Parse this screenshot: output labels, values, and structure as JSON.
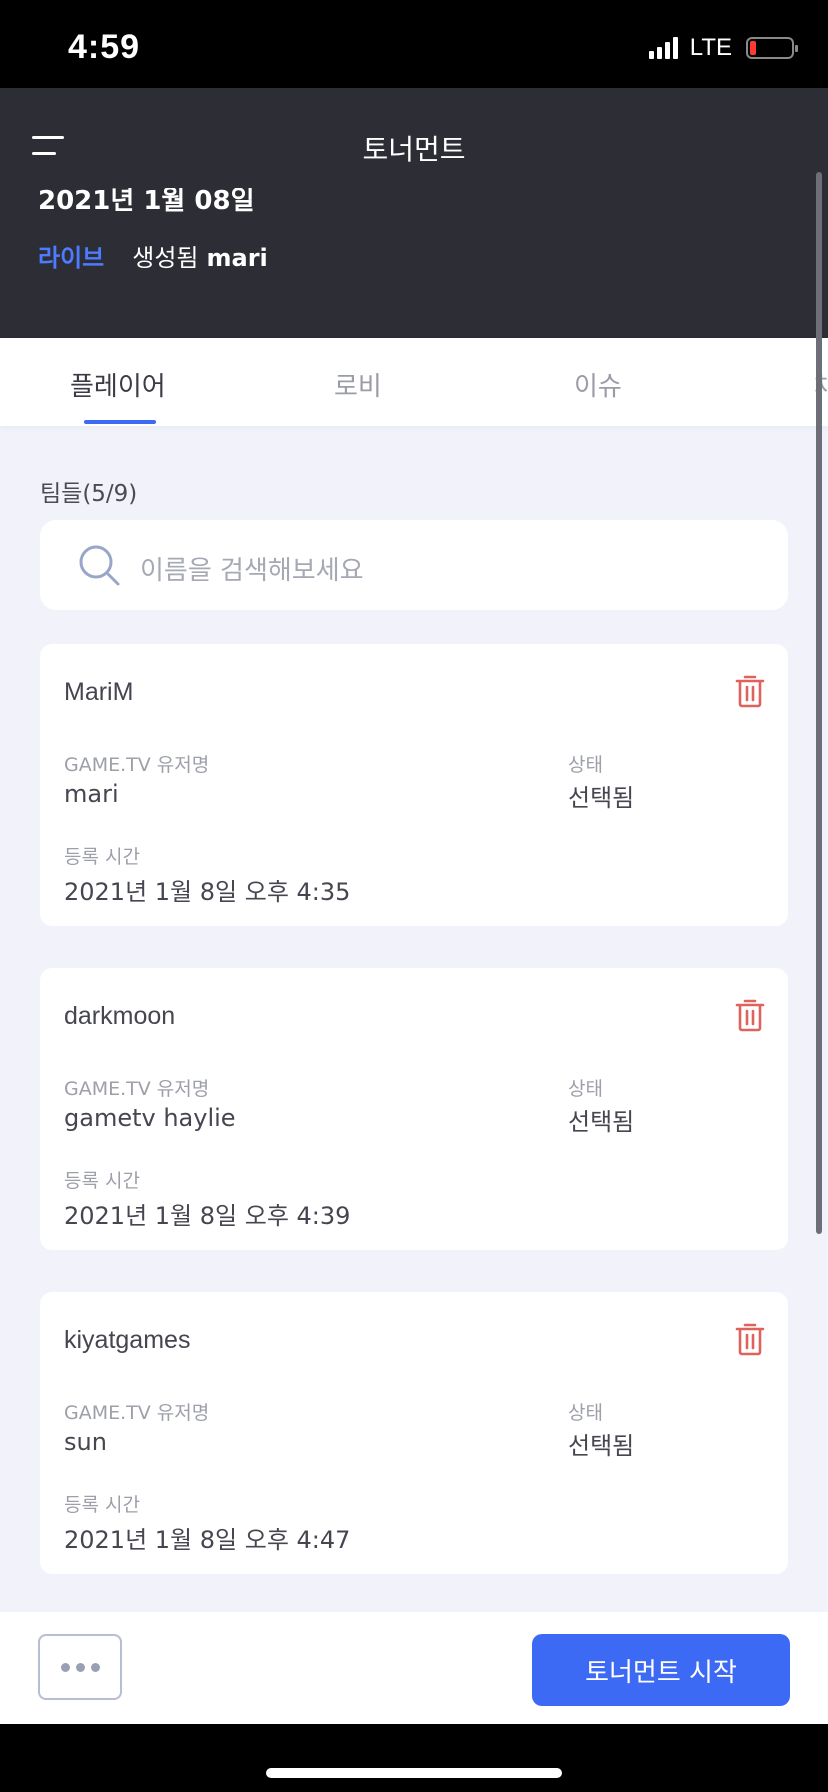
{
  "status_bar": {
    "time": "4:59",
    "network": "LTE"
  },
  "header": {
    "title": "토너먼트",
    "date": "2021년 1월 08일",
    "live_label": "라이브",
    "created_label": "생성됨",
    "created_user": "mari"
  },
  "tabs": [
    {
      "label": "플레이어",
      "active": true
    },
    {
      "label": "로비",
      "active": false
    },
    {
      "label": "이슈",
      "active": false
    },
    {
      "label": "채",
      "active": false
    }
  ],
  "teams": {
    "label": "팀들(5/9)",
    "search_placeholder": "이름을 검색해보세요"
  },
  "field_labels": {
    "username": "GAME.TV 유저명",
    "status": "상태",
    "registered": "등록 시간"
  },
  "cards": [
    {
      "name": "MariM",
      "username": "mari",
      "status": "선택됨",
      "registered": "2021년 1월 8일 오후 4:35"
    },
    {
      "name": "darkmoon",
      "username": "gametv haylie",
      "status": "선택됨",
      "registered": "2021년 1월 8일 오후 4:39"
    },
    {
      "name": "kiyatgames",
      "username": "sun",
      "status": "선택됨",
      "registered": "2021년 1월 8일 오후 4:47"
    }
  ],
  "bottom": {
    "start_label": "토너먼트 시작"
  },
  "colors": {
    "accent": "#3c6af5",
    "header_bg": "#2c2d35",
    "trash": "#e0625c"
  }
}
